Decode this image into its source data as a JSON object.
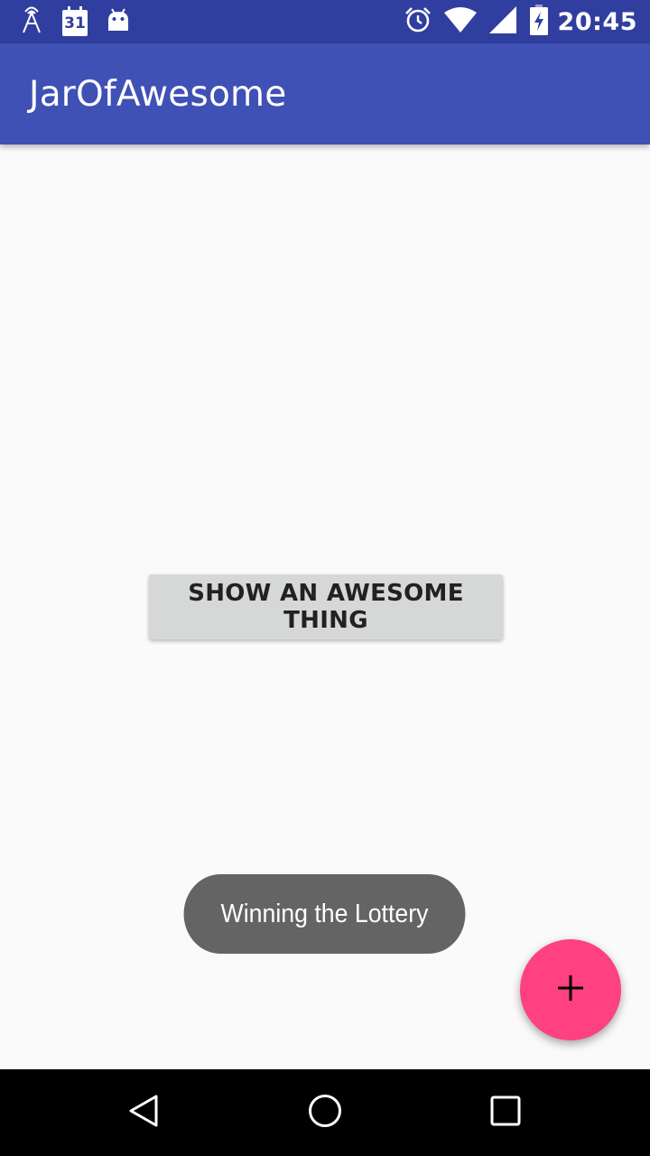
{
  "status_bar": {
    "time": "20:45",
    "calendar_day": "31",
    "left_icons": [
      "signal-tower-icon",
      "calendar-icon",
      "android-icon"
    ],
    "right_icons": [
      "alarm-clock-icon",
      "wifi-icon",
      "cell-signal-icon",
      "battery-charging-icon"
    ],
    "background_color": "#303F9F"
  },
  "app_bar": {
    "title": "JarOfAwesome",
    "background_color": "#3F51B5"
  },
  "main": {
    "show_button_label": "SHOW AN AWESOME THING",
    "toast_message": "Winning the Lottery",
    "fab_icon": "plus-icon",
    "fab_color": "#FF4081"
  },
  "nav_bar": {
    "buttons": [
      "back-icon",
      "home-icon",
      "recents-icon"
    ]
  }
}
